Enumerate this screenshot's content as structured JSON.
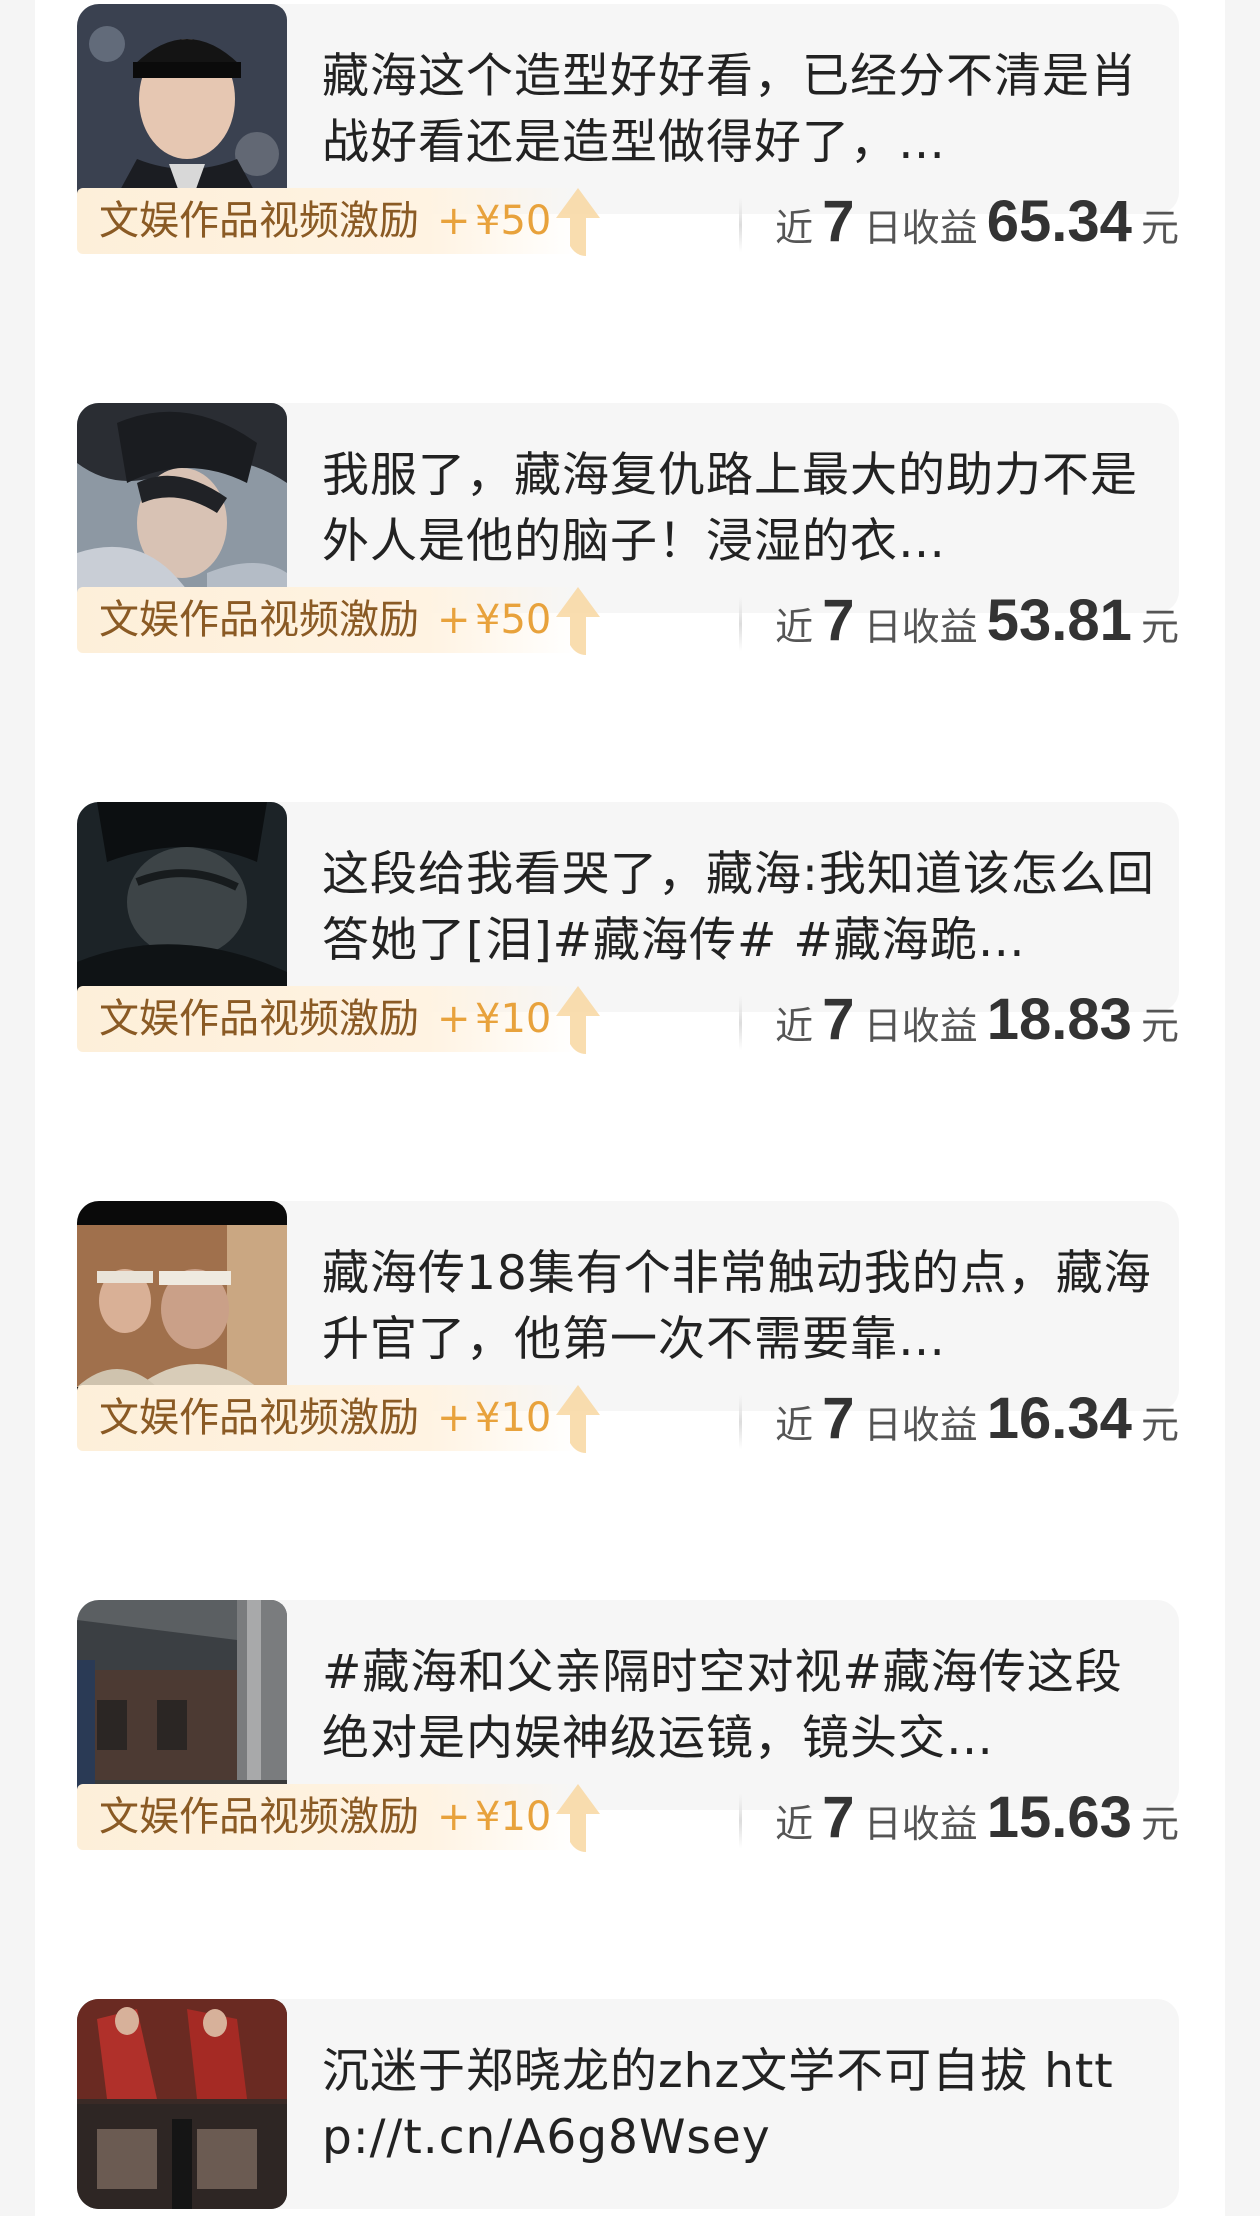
{
  "items": [
    {
      "text": "藏海这个造型好好看，已经分不清是肖战好看还是造型做得好了，…",
      "thumb": "portrait-headband-icon",
      "reward": {
        "label": "文娱作品视频激励",
        "plus": "+",
        "amount": "¥50"
      },
      "earn": {
        "prefix": "近",
        "days": "7",
        "mid": "日收益",
        "value": "65.34",
        "unit": "元"
      }
    },
    {
      "text": "我服了，藏海复仇路上最大的助力不是外人是他的脑子！浸湿的衣…",
      "thumb": "portrait-wet-hair-icon",
      "reward": {
        "label": "文娱作品视频激励",
        "plus": "+",
        "amount": "¥50"
      },
      "earn": {
        "prefix": "近",
        "days": "7",
        "mid": "日收益",
        "value": "53.81",
        "unit": "元"
      }
    },
    {
      "text": "这段给我看哭了，藏海:我知道该怎么回答她了[泪]#藏海传# #藏海跪…",
      "thumb": "portrait-dark-scene-icon",
      "reward": {
        "label": "文娱作品视频激励",
        "plus": "+",
        "amount": "¥10"
      },
      "earn": {
        "prefix": "近",
        "days": "7",
        "mid": "日收益",
        "value": "18.83",
        "unit": "元"
      }
    },
    {
      "text": "藏海传18集有个非常触动我的点，藏海升官了，他第一次不需要靠…",
      "thumb": "scene-two-men-icon",
      "reward": {
        "label": "文娱作品视频激励",
        "plus": "+",
        "amount": "¥10"
      },
      "earn": {
        "prefix": "近",
        "days": "7",
        "mid": "日收益",
        "value": "16.34",
        "unit": "元"
      }
    },
    {
      "text": "#藏海和父亲隔时空对视#藏海传这段绝对是内娱神级运镜，镜头交…",
      "thumb": "scene-palace-courtyard-icon",
      "reward": {
        "label": "文娱作品视频激励",
        "plus": "+",
        "amount": "¥10"
      },
      "earn": {
        "prefix": "近",
        "days": "7",
        "mid": "日收益",
        "value": "15.63",
        "unit": "元"
      }
    },
    {
      "text": "沉迷于郑晓龙的zhz文学不可自拔 http://t.cn/A6g8Wsey",
      "thumb": "scene-red-robes-icon"
    }
  ]
}
